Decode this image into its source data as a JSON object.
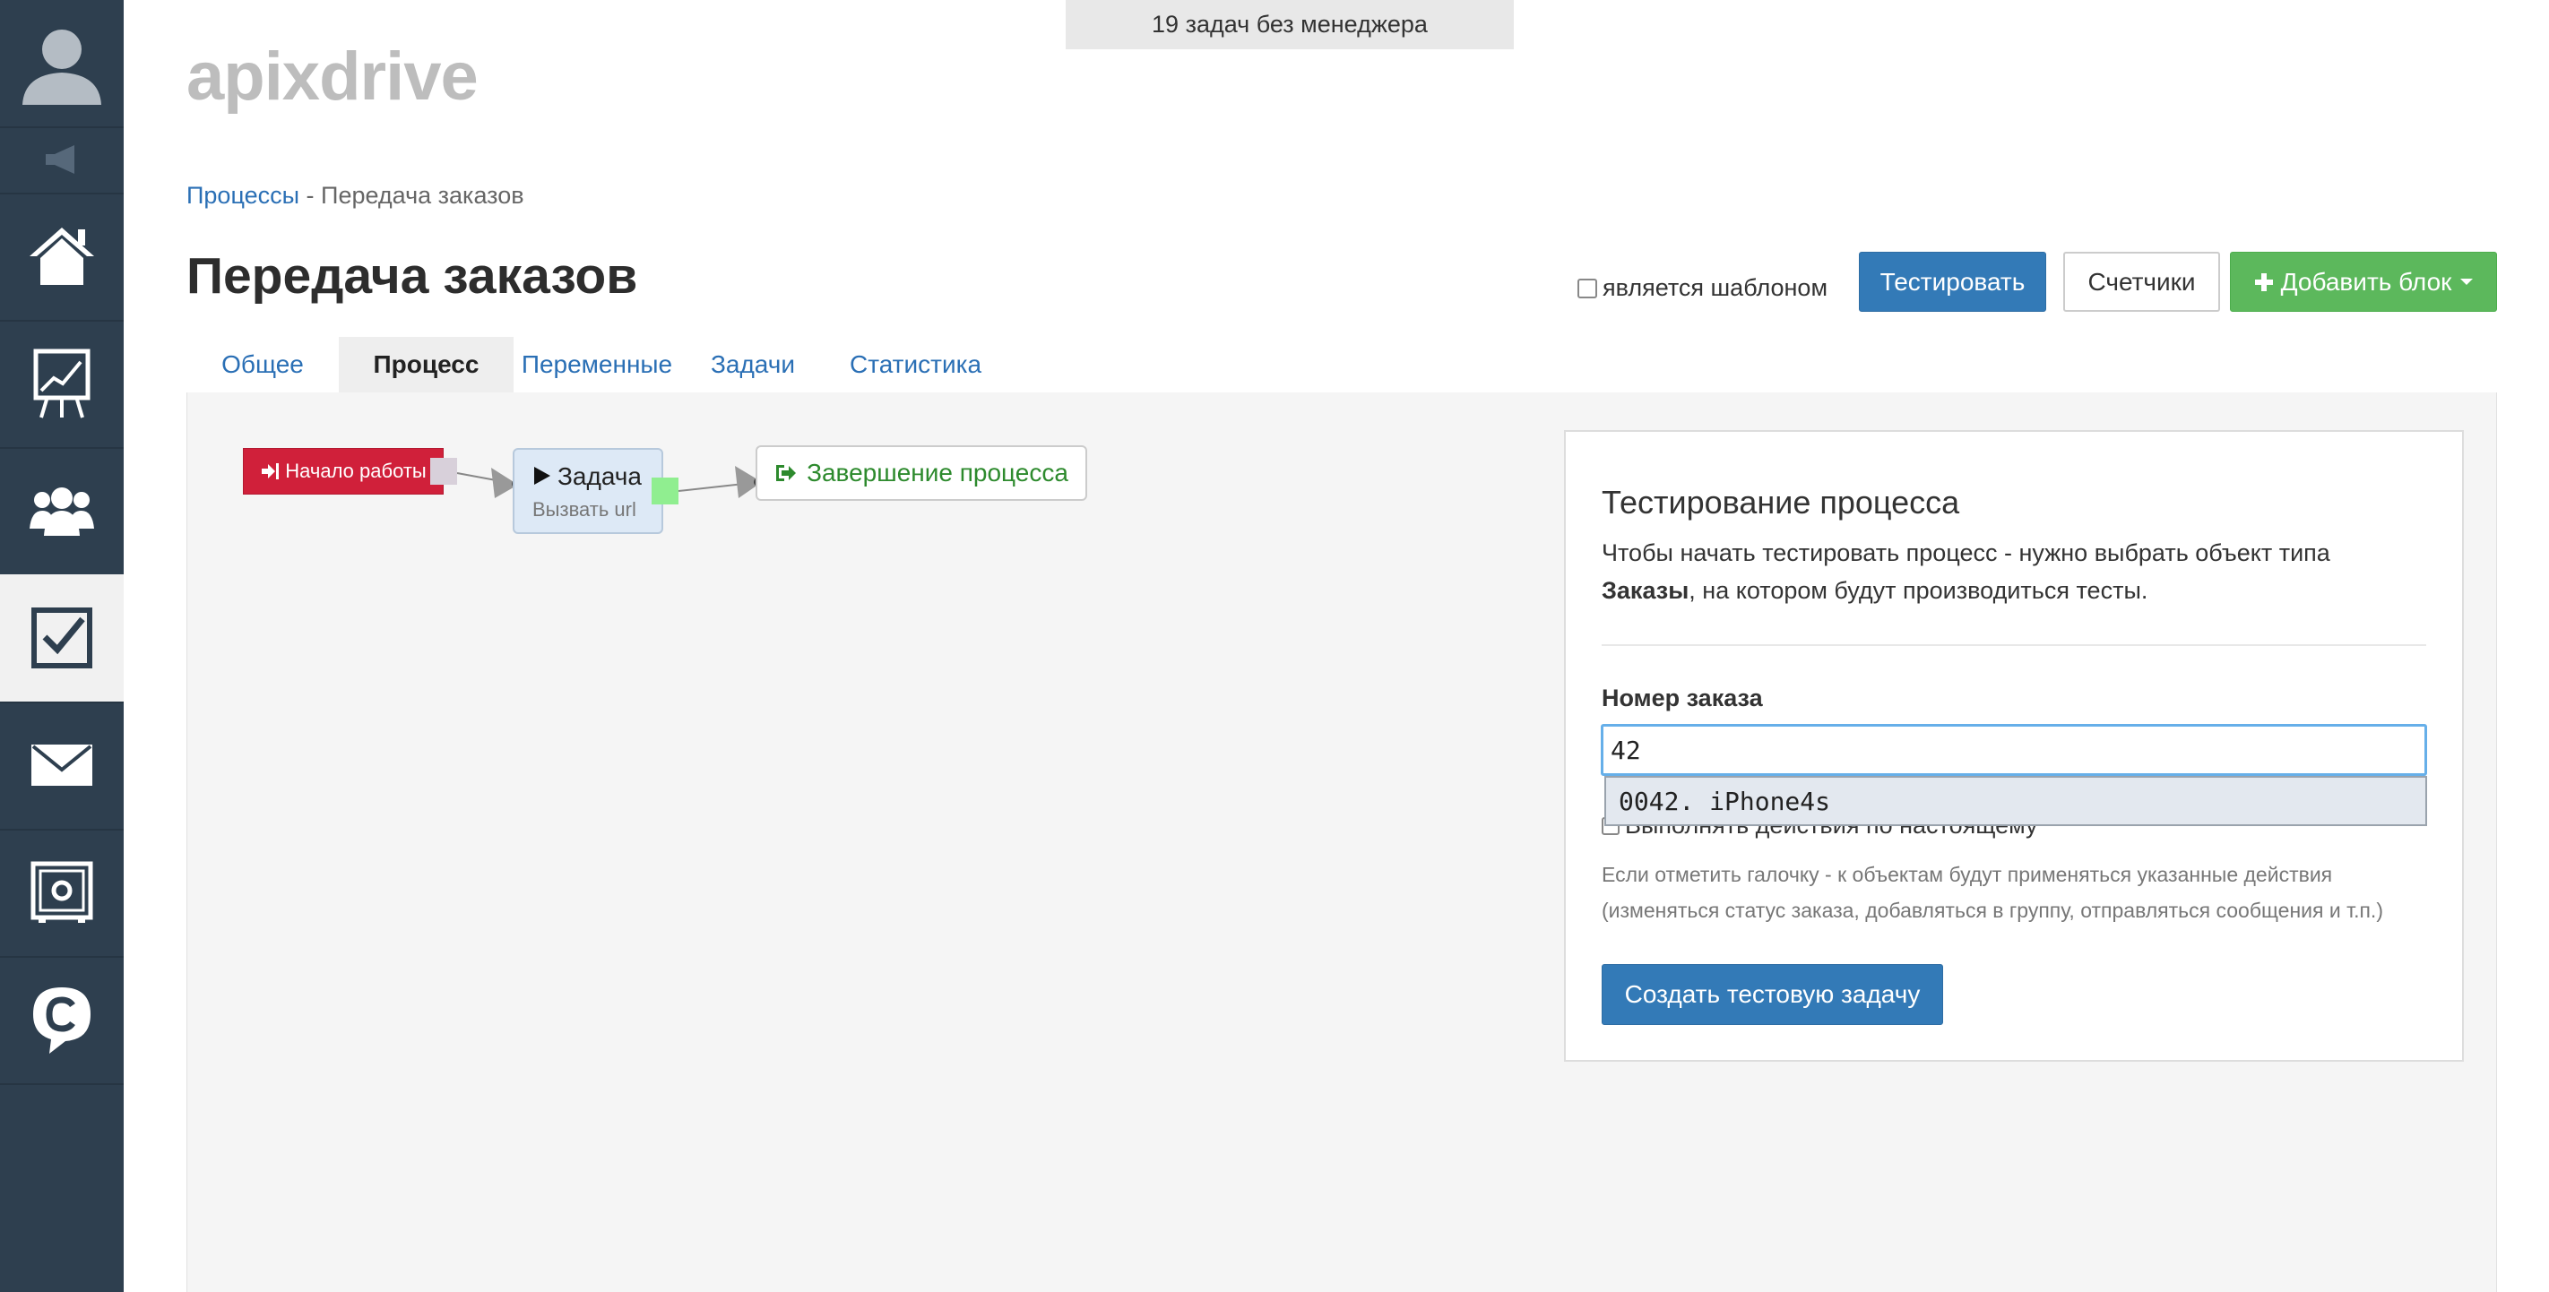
{
  "sidebar": {
    "items": [
      {
        "icon": "user-avatar-icon",
        "active": false
      },
      {
        "icon": "megaphone-icon",
        "active": false
      },
      {
        "icon": "home-icon",
        "active": false
      },
      {
        "icon": "chart-board-icon",
        "active": false
      },
      {
        "icon": "users-group-icon",
        "active": false
      },
      {
        "icon": "checkbox-icon",
        "active": true
      },
      {
        "icon": "mail-icon",
        "active": false
      },
      {
        "icon": "safe-settings-icon",
        "active": false
      },
      {
        "icon": "chat-c-icon",
        "active": false
      }
    ]
  },
  "banner": {
    "text": "19 задач без менеджера"
  },
  "logo": {
    "text": "apixdrive"
  },
  "breadcrumb": {
    "link": "Процессы",
    "separator": " - ",
    "current": "Передача заказов"
  },
  "page": {
    "title": "Передача заказов"
  },
  "controls": {
    "template_label": "является шаблоном",
    "template_checked": false,
    "test_button": "Тестировать",
    "counters_button": "Счетчики",
    "add_block_button": "Добавить блок"
  },
  "tabs": [
    {
      "label": "Общее",
      "active": false
    },
    {
      "label": "Процесс",
      "active": true
    },
    {
      "label": "Переменные",
      "active": false
    },
    {
      "label": "Задачи",
      "active": false
    },
    {
      "label": "Статистика",
      "active": false
    }
  ],
  "flow": {
    "start_label": "Начало работы",
    "task_title": "Задача",
    "task_subtitle": "Вызвать url",
    "end_label": "Завершение процесса"
  },
  "test_panel": {
    "title": "Тестирование процесса",
    "desc_part1": "Чтобы начать тестировать процесс - нужно выбрать объект типа ",
    "desc_bold": "Заказы",
    "desc_part2": ", на котором будут производиться тесты.",
    "field_label": "Номер заказа",
    "input_value": "42",
    "suggestion": "0042. iPhone4s",
    "real_actions_label": "Выполнять действия по настоящему",
    "hint_line1": "Если отметить галочку - к объектам будут применяться указанные действия",
    "hint_line2": "(изменяться статус заказа, добавляться в группу, отправляться сообщения и т.п.)",
    "create_button": "Создать тестовую задачу"
  },
  "colors": {
    "sidebar_bg": "#2e3f4f",
    "primary": "#337ab7",
    "success": "#5cb85c",
    "danger": "#d0203a",
    "link": "#2a6fb5"
  }
}
